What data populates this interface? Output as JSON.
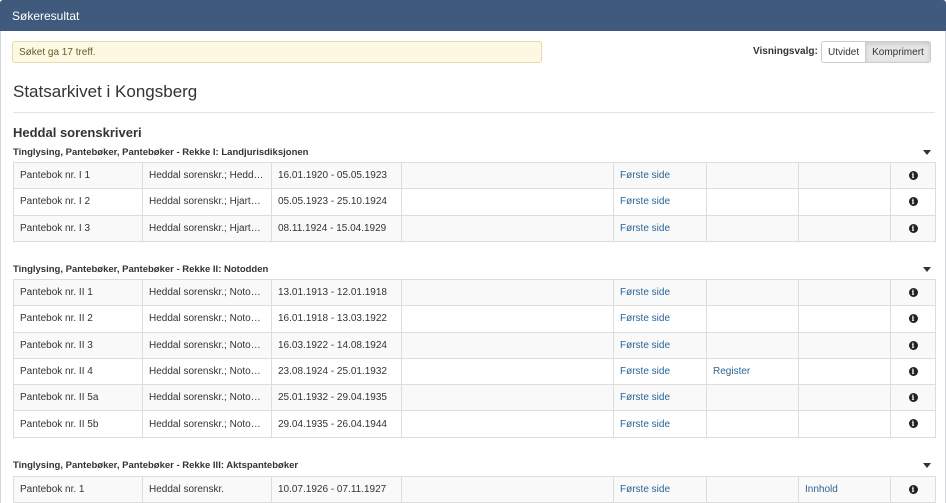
{
  "header": {
    "title": "Søkeresultat"
  },
  "alert": {
    "text": "Søket ga 17 treff."
  },
  "view_options": {
    "label": "Visningsvalg:",
    "expanded_label": "Utvidet",
    "compressed_label": "Komprimert",
    "selected": "Komprimert"
  },
  "archive": {
    "title": "Statsarkivet i Kongsberg"
  },
  "organization": {
    "title": "Heddal sorenskriveri"
  },
  "series": [
    {
      "title": "Tinglysing, Pantebøker, Pantebøker - Rekke I: Landjurisdiksjonen",
      "rows": [
        {
          "name": "Pantebok nr. I 1",
          "creator": "Heddal sorenskr.; Heddal...",
          "period": "16.01.1920 - 05.05.1923",
          "extra": "",
          "first_page": "Første side",
          "register": "",
          "content": ""
        },
        {
          "name": "Pantebok nr. I 2",
          "creator": "Heddal sorenskr.; Hjartda...",
          "period": "05.05.1923 - 25.10.1924",
          "extra": "",
          "first_page": "Første side",
          "register": "",
          "content": ""
        },
        {
          "name": "Pantebok nr. I 3",
          "creator": "Heddal sorenskr.; Hjartda...",
          "period": "08.11.1924 - 15.04.1929",
          "extra": "",
          "first_page": "Første side",
          "register": "",
          "content": ""
        }
      ]
    },
    {
      "title": "Tinglysing, Pantebøker, Pantebøker - Rekke II: Notodden",
      "rows": [
        {
          "name": "Pantebok nr. II 1",
          "creator": "Heddal sorenskr.; Notodd...",
          "period": "13.01.1913 - 12.01.1918",
          "extra": "",
          "first_page": "Første side",
          "register": "",
          "content": ""
        },
        {
          "name": "Pantebok nr. II 2",
          "creator": "Heddal sorenskr.; Notodd...",
          "period": "16.01.1918 - 13.03.1922",
          "extra": "",
          "first_page": "Første side",
          "register": "",
          "content": ""
        },
        {
          "name": "Pantebok nr. II 3",
          "creator": "Heddal sorenskr.; Notodd...",
          "period": "16.03.1922 - 14.08.1924",
          "extra": "",
          "first_page": "Første side",
          "register": "",
          "content": ""
        },
        {
          "name": "Pantebok nr. II 4",
          "creator": "Heddal sorenskr.; Notodd...",
          "period": "23.08.1924 - 25.01.1932",
          "extra": "",
          "first_page": "Første side",
          "register": "Register",
          "content": ""
        },
        {
          "name": "Pantebok nr. II 5a",
          "creator": "Heddal sorenskr.; Notodd...",
          "period": "25.01.1932 - 29.04.1935",
          "extra": "",
          "first_page": "Første side",
          "register": "",
          "content": ""
        },
        {
          "name": "Pantebok nr. II 5b",
          "creator": "Heddal sorenskr.; Notodd...",
          "period": "29.04.1935 - 26.04.1944",
          "extra": "",
          "first_page": "Første side",
          "register": "",
          "content": ""
        }
      ]
    },
    {
      "title": "Tinglysing, Pantebøker, Pantebøker - Rekke III: Aktspantebøker",
      "rows": [
        {
          "name": "Pantebok nr. 1",
          "creator": "Heddal sorenskr.",
          "period": "10.07.1926 - 07.11.1927",
          "extra": "",
          "first_page": "Første side",
          "register": "",
          "content": "Innhold"
        }
      ]
    }
  ],
  "icons": {
    "info": "info-circle-icon",
    "caret": "caret-down-icon"
  }
}
